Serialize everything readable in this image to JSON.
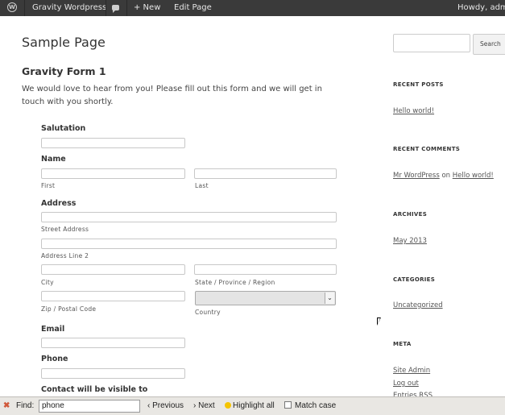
{
  "adminbar": {
    "site_name": "Gravity Wordpress",
    "new_label": "+ New",
    "edit_label": "Edit Page",
    "howdy": "Howdy, admi"
  },
  "page": {
    "title": "Sample Page",
    "form_title": "Gravity Form 1",
    "description": "We would love to hear from you! Please fill out this form and we will get in touch with you shortly."
  },
  "form": {
    "salutation": "Salutation",
    "name": "Name",
    "first": "First",
    "last": "Last",
    "address": "Address",
    "street": "Street Address",
    "line2": "Address Line 2",
    "city": "City",
    "state": "State / Province / Region",
    "zip": "Zip / Postal Code",
    "country": "Country",
    "email": "Email",
    "phone": "Phone",
    "contact": "Contact will be visible to"
  },
  "sidebar": {
    "search_button": "Search",
    "recent_posts_title": "RECENT POSTS",
    "recent_post": "Hello world!",
    "recent_comments_title": "RECENT COMMENTS",
    "comment_author": "Mr WordPress",
    "comment_on": " on ",
    "comment_post": "Hello world!",
    "archives_title": "ARCHIVES",
    "archive": "May 2013",
    "categories_title": "CATEGORIES",
    "category": "Uncategorized",
    "meta_title": "META",
    "meta_site_admin": "Site Admin",
    "meta_logout": "Log out",
    "meta_rss": "Entries RSS"
  },
  "findbar": {
    "find_label": "Find:",
    "query": "phone",
    "previous": "Previous",
    "next": "Next",
    "highlight": "Highlight all",
    "match_case": "Match case"
  }
}
